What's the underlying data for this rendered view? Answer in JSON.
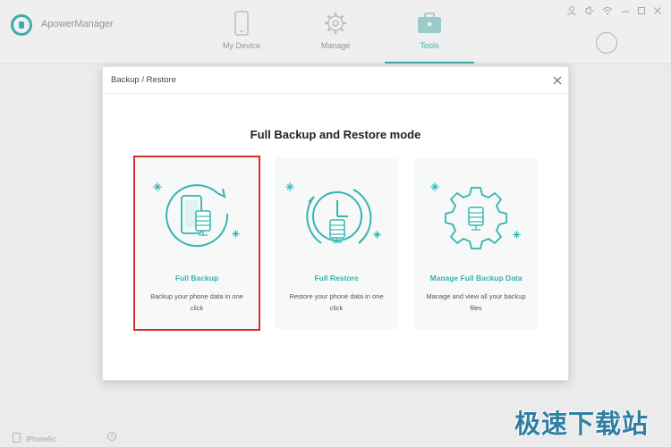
{
  "app": {
    "title": "ApowerManager",
    "tabs": [
      {
        "label": "My Device",
        "icon": "phone-icon"
      },
      {
        "label": "Manage",
        "icon": "gear-icon"
      },
      {
        "label": "Tools",
        "icon": "toolbox-icon"
      }
    ],
    "active_tab": "Tools",
    "accent_color": "#34b5b0"
  },
  "status": {
    "device_name": "iPhone5c"
  },
  "dialog": {
    "title": "Backup / Restore",
    "headline": "Full Backup and Restore mode",
    "cards": [
      {
        "title": "Full Backup",
        "description": "Backup your phone data in one click",
        "selected": true
      },
      {
        "title": "Full Restore",
        "description": "Restore your phone data in one click",
        "selected": false
      },
      {
        "title": "Manage Full Backup Data",
        "description": "Manage and view all your backup files",
        "selected": false
      }
    ]
  },
  "watermark": "极速下载站"
}
